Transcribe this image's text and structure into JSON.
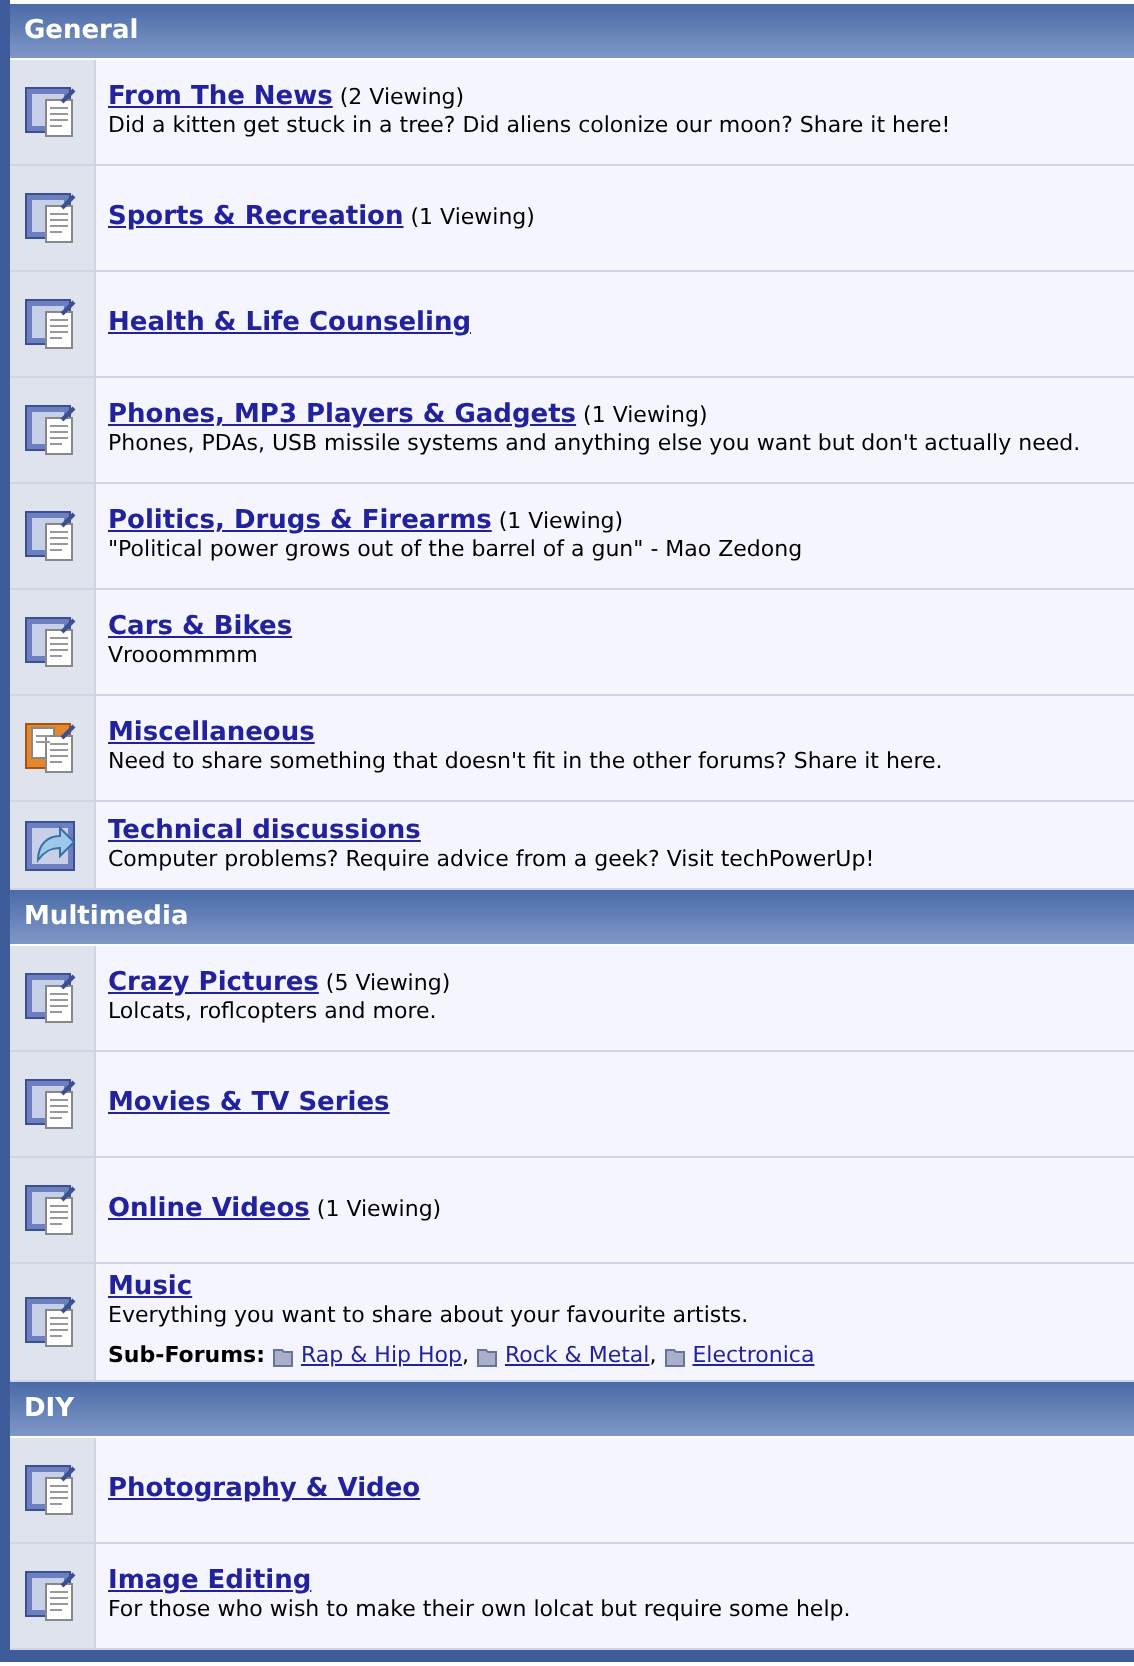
{
  "categories": [
    {
      "title": "General",
      "forums": [
        {
          "kind": "forum",
          "name": "From The News",
          "viewing": "(2 Viewing)",
          "description": "Did a kitten get stuck in a tree? Did aliens colonize our moon? Share it here!"
        },
        {
          "kind": "forum",
          "name": "Sports & Recreation",
          "viewing": "(1 Viewing)"
        },
        {
          "kind": "forum",
          "name": "Health & Life Counseling"
        },
        {
          "kind": "forum",
          "name": "Phones, MP3 Players & Gadgets",
          "viewing": "(1 Viewing)",
          "description": "Phones, PDAs, USB missile systems and anything else you want but don't actually need."
        },
        {
          "kind": "forum",
          "name": "Politics, Drugs & Firearms",
          "viewing": "(1 Viewing)",
          "description": "\"Political power grows out of the barrel of a gun\" - Mao Zedong"
        },
        {
          "kind": "forum",
          "name": "Cars & Bikes",
          "description": "Vrooommmm"
        },
        {
          "kind": "multi",
          "name": "Miscellaneous",
          "description": "Need to share something that doesn't fit in the other forums? Share it here."
        },
        {
          "kind": "link",
          "name": "Technical discussions",
          "description": "Computer problems? Require advice from a geek? Visit techPowerUp!"
        }
      ]
    },
    {
      "title": "Multimedia",
      "forums": [
        {
          "kind": "forum",
          "name": "Crazy Pictures",
          "viewing": "(5 Viewing)",
          "description": "Lolcats, roflcopters and more."
        },
        {
          "kind": "forum",
          "name": "Movies & TV Series"
        },
        {
          "kind": "forum",
          "name": "Online Videos",
          "viewing": "(1 Viewing)"
        },
        {
          "kind": "forum",
          "name": "Music",
          "description": "Everything you want to share about your favourite artists.",
          "subforums_label": "Sub-Forums:",
          "subforum_separator": ",",
          "subforums": [
            "Rap & Hip Hop",
            "Rock & Metal",
            "Electronica"
          ]
        }
      ]
    },
    {
      "title": "DIY",
      "forums": [
        {
          "kind": "forum",
          "name": "Photography & Video"
        },
        {
          "kind": "forum",
          "name": "Image Editing",
          "description": "For those who wish to make their own lolcat but require some help."
        }
      ]
    }
  ]
}
